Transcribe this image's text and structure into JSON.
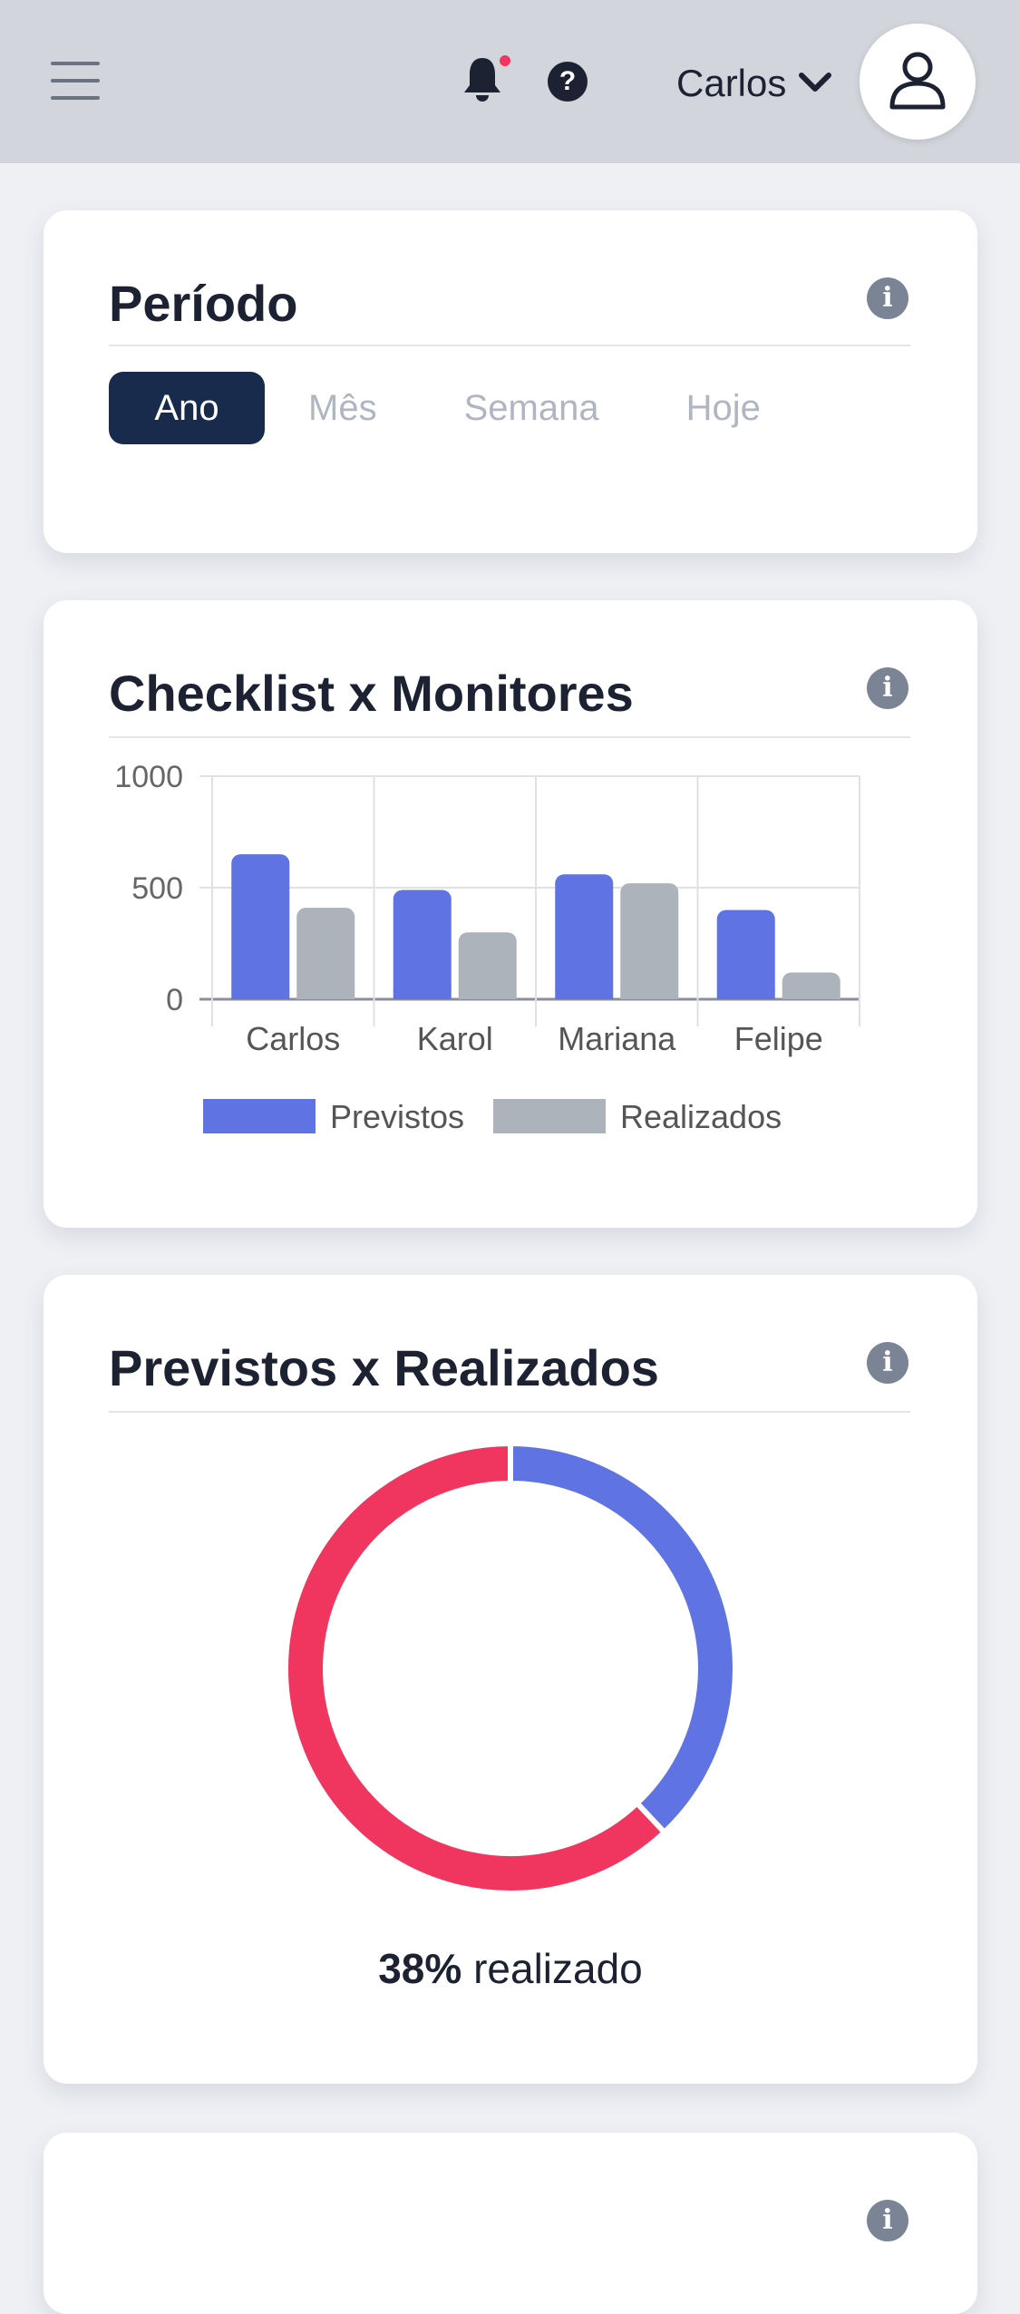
{
  "header": {
    "user_name": "Carlos",
    "icons": [
      "menu-icon",
      "bell-icon",
      "help-icon",
      "chevron-down-icon",
      "user-icon"
    ],
    "notification_dot_color": "#f0365f"
  },
  "periodo": {
    "title": "Período",
    "tabs": [
      "Ano",
      "Mês",
      "Semana",
      "Hoje"
    ],
    "active_tab": "Ano"
  },
  "checklist": {
    "title": "Checklist x Monitores"
  },
  "previstos": {
    "title": "Previstos x Realizados",
    "percent": "38%",
    "percent_suffix": "realizado"
  },
  "chart_data": [
    {
      "type": "bar",
      "categories": [
        "Carlos",
        "Karol",
        "Mariana",
        "Felipe"
      ],
      "series": [
        {
          "name": "Previstos",
          "values": [
            650,
            490,
            560,
            400
          ],
          "color": "#5f73e3"
        },
        {
          "name": "Realizados",
          "values": [
            410,
            300,
            520,
            120
          ],
          "color": "#adb3ba"
        }
      ],
      "ylim": [
        0,
        1000
      ],
      "yticks": [
        0,
        500,
        1000
      ],
      "grid": true,
      "legend": "bottom"
    },
    {
      "type": "pie",
      "variant": "donut",
      "slices": [
        {
          "value": 38,
          "color": "#5f73e3"
        },
        {
          "value": 62,
          "color": "#f0365f"
        }
      ]
    }
  ]
}
